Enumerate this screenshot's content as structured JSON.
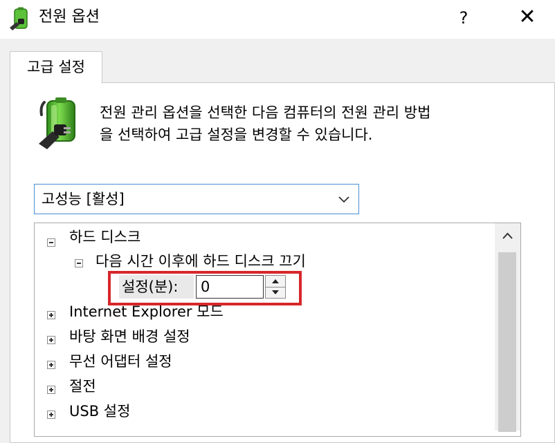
{
  "window": {
    "title": "전원 옵션",
    "help_label": "?",
    "close_label": "✕"
  },
  "tabs": [
    {
      "label": "고급 설정"
    }
  ],
  "description": {
    "line1": "전원 관리 옵션을 선택한 다음 컴퓨터의 전원 관리 방법",
    "line2": "을 선택하여 고급 설정을 변경할 수 있습니다."
  },
  "plan_select": {
    "value": "고성능 [활성]"
  },
  "tree": {
    "items": [
      {
        "label": "하드 디스크",
        "expander": "minus"
      },
      {
        "label": "다음 시간 이후에 하드 디스크 끄기",
        "expander": "minus"
      },
      {
        "label": "Internet Explorer 모드",
        "expander": "plus"
      },
      {
        "label": "바탕 화면 배경 설정",
        "expander": "plus"
      },
      {
        "label": "무선 어댑터 설정",
        "expander": "plus"
      },
      {
        "label": "절전",
        "expander": "plus"
      },
      {
        "label": "USB 설정",
        "expander": "plus"
      }
    ],
    "setting": {
      "label": "설정(분):",
      "value": "0"
    }
  },
  "icons": {
    "app": "power-battery-icon",
    "dropdown": "chevron-down-icon",
    "scroll_up": "chevron-up-icon"
  },
  "colors": {
    "highlight_border": "#d7262b",
    "select_border": "#4a8ed6",
    "battery_green": "#4caf2b"
  }
}
